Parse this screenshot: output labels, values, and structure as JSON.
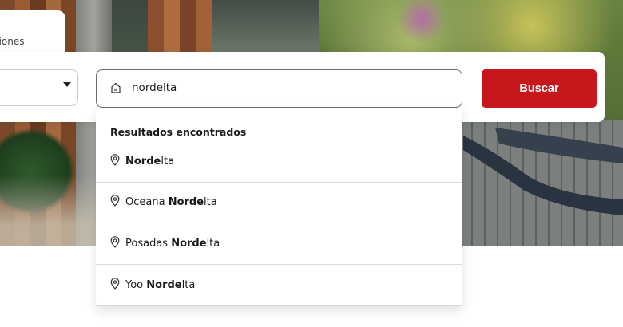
{
  "tabs": {
    "partial_label": "ersiones"
  },
  "search": {
    "value": "nordelta",
    "button_label": "Buscar"
  },
  "results": {
    "title": "Resultados encontrados",
    "items": [
      {
        "prefix": "",
        "match": "Norde",
        "suffix": "lta"
      },
      {
        "prefix": "Oceana ",
        "match": "Norde",
        "suffix": "lta"
      },
      {
        "prefix": "Posadas ",
        "match": "Norde",
        "suffix": "lta"
      },
      {
        "prefix": "Yoo ",
        "match": "Norde",
        "suffix": "lta"
      }
    ]
  },
  "colors": {
    "accent": "#c8161d",
    "text": "#1a1a1a"
  },
  "icons": {
    "input_icon": "home-icon",
    "result_icon": "map-pin-icon",
    "select_icon": "caret-down-icon"
  }
}
